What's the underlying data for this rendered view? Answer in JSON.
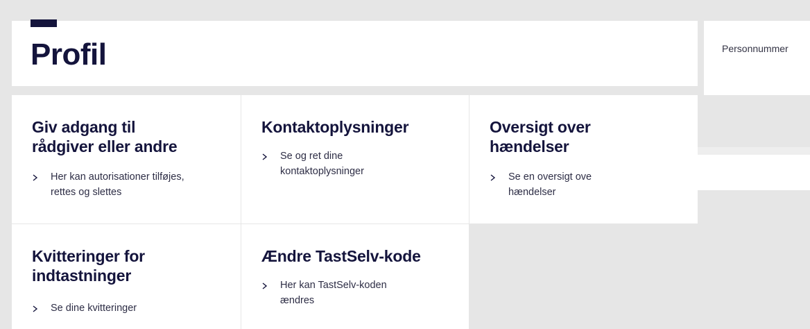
{
  "header": {
    "title": "Profil"
  },
  "side": {
    "personnummer_label": "Personnummer"
  },
  "tiles": [
    {
      "title": "Giv adgang til rådgiver eller andre",
      "link_line1": "Her kan autorisationer tilføjes,",
      "link_line2": "rettes og slettes"
    },
    {
      "title": "Kontaktoplysninger",
      "link_line1": "Se og ret dine",
      "link_line2": "kontaktoplysninger"
    },
    {
      "title": "Oversigt over hændelser",
      "title_line1": "Oversigt over",
      "title_line2": "hændelser",
      "link_line1": "Se en oversigt ove",
      "link_line2": "hændelser"
    },
    {
      "title_line1": "Kvitteringer for",
      "title_line2": "indtastninger",
      "link_line1": "Se dine kvitteringer"
    },
    {
      "title": "Ændre TastSelv-kode",
      "link_line1": "Her kan TastSelv-koden",
      "link_line2": "ændres"
    }
  ],
  "tile0_title_lines": [
    "Giv adgang til",
    "rådgiver eller andre"
  ]
}
